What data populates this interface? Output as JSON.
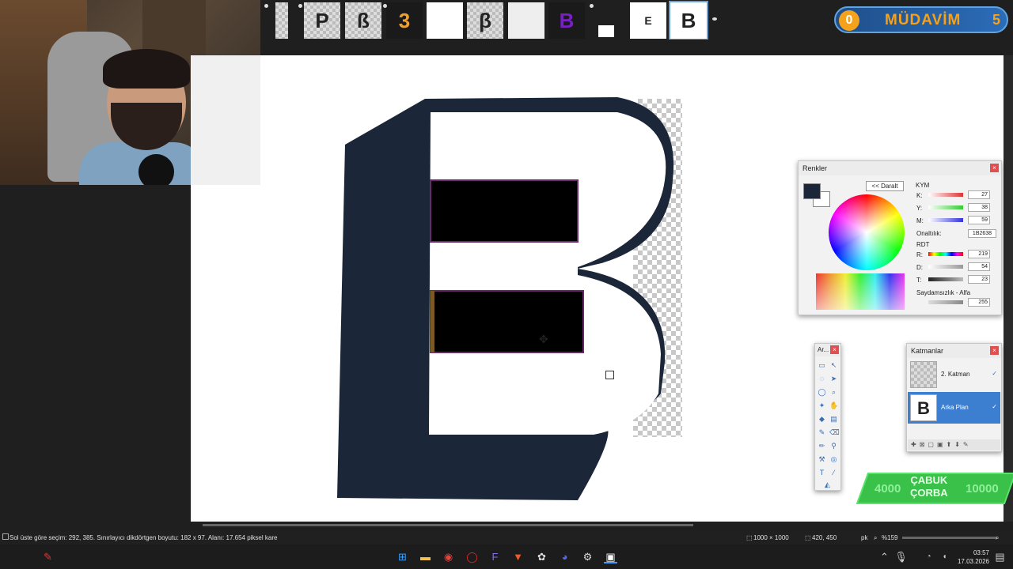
{
  "overlay": {
    "mudavim_count": "0",
    "mudavim_label": "MÜDAVİM",
    "mudavim_level": "5",
    "corba_label_line1": "ÇABUK",
    "corba_label_line2": "ÇORBA",
    "corba_left": "4000",
    "corba_right": "10000"
  },
  "thumbnails": [
    {
      "label": ""
    },
    {
      "label": "P"
    },
    {
      "label": "ß"
    },
    {
      "label": "3"
    },
    {
      "label": ""
    },
    {
      "label": "β"
    },
    {
      "label": ""
    },
    {
      "label": "B"
    },
    {
      "label": ""
    },
    {
      "label": "E"
    },
    {
      "label": "B"
    }
  ],
  "colors_panel": {
    "title": "Renkler",
    "collapse_button": "<< Daralt",
    "cmyk_header": "KYM",
    "k_label": "K:",
    "k_value": "27",
    "y_label": "Y:",
    "y_value": "38",
    "m_label": "M:",
    "m_value": "59",
    "hex_label": "Onaltılık:",
    "hex_value": "1B2638",
    "rgb_header": "RDT",
    "r_label": "R:",
    "r_value": "219",
    "d_label": "D:",
    "d_value": "54",
    "t_label": "T:",
    "t_value": "23",
    "alpha_label": "Saydamsızlık - Alfa",
    "alpha_value": "255"
  },
  "tools_panel": {
    "title": "Ar..."
  },
  "layers_panel": {
    "title": "Katmanlar",
    "layers": [
      {
        "name": "2. Katman",
        "visible": "✓"
      },
      {
        "name": "Arka Plan",
        "visible": "✓",
        "thumb": "B"
      }
    ]
  },
  "statusbar": {
    "selection_info": "Sol üste göre seçim: 292, 385. Sınırlayıcı dikdörtgen boyutu: 182 x 97. Alanı: 17.654 piksel kare",
    "image_size": "1000 × 1000",
    "cursor_pos": "420, 450",
    "unit": "pk",
    "zoom": "%159"
  },
  "clock": {
    "time": "03:57",
    "date": "17.03.2026"
  },
  "colors": {
    "primary": "#1b2638",
    "accent": "#3c7fd0"
  }
}
